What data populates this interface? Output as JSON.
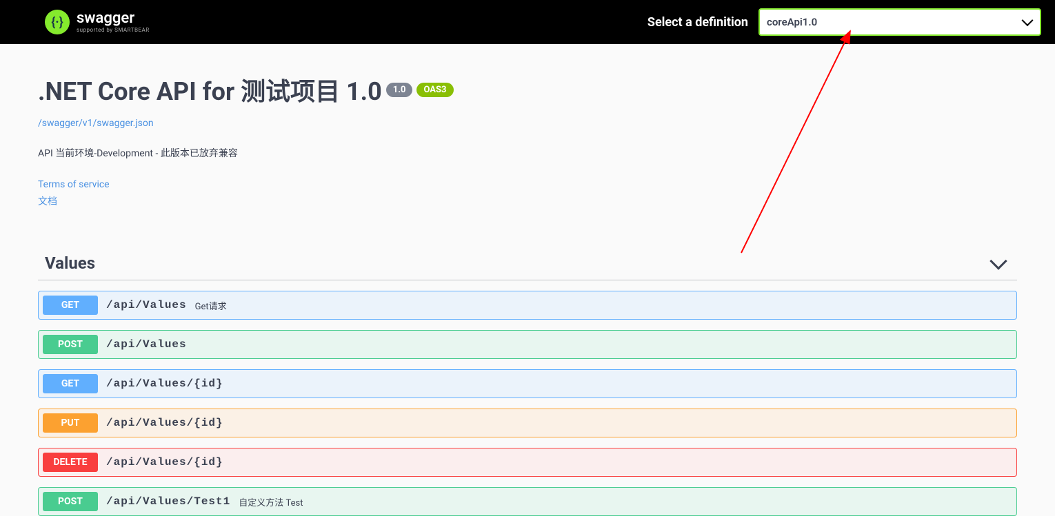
{
  "topbar": {
    "logo_main": "swagger",
    "logo_sub": "supported by SMARTBEAR",
    "definition_label": "Select a definition",
    "definition_selected": "coreApi1.0"
  },
  "info": {
    "title": ".NET Core API for 测试项目 1.0",
    "version_badge": "1.0",
    "oas_badge": "OAS3",
    "swagger_url": "/swagger/v1/swagger.json",
    "description": "API 当前环境-Development - 此版本已放弃兼容",
    "terms_link": "Terms of service",
    "docs_link": "文档"
  },
  "tag": {
    "name": "Values"
  },
  "operations": [
    {
      "method": "GET",
      "class": "get",
      "path": "/api/Values",
      "summary": "Get请求"
    },
    {
      "method": "POST",
      "class": "post",
      "path": "/api/Values",
      "summary": ""
    },
    {
      "method": "GET",
      "class": "get",
      "path": "/api/Values/{id}",
      "summary": ""
    },
    {
      "method": "PUT",
      "class": "put",
      "path": "/api/Values/{id}",
      "summary": ""
    },
    {
      "method": "DELETE",
      "class": "delete",
      "path": "/api/Values/{id}",
      "summary": ""
    },
    {
      "method": "POST",
      "class": "post",
      "path": "/api/Values/Test1",
      "summary": "自定义方法 Test"
    }
  ]
}
